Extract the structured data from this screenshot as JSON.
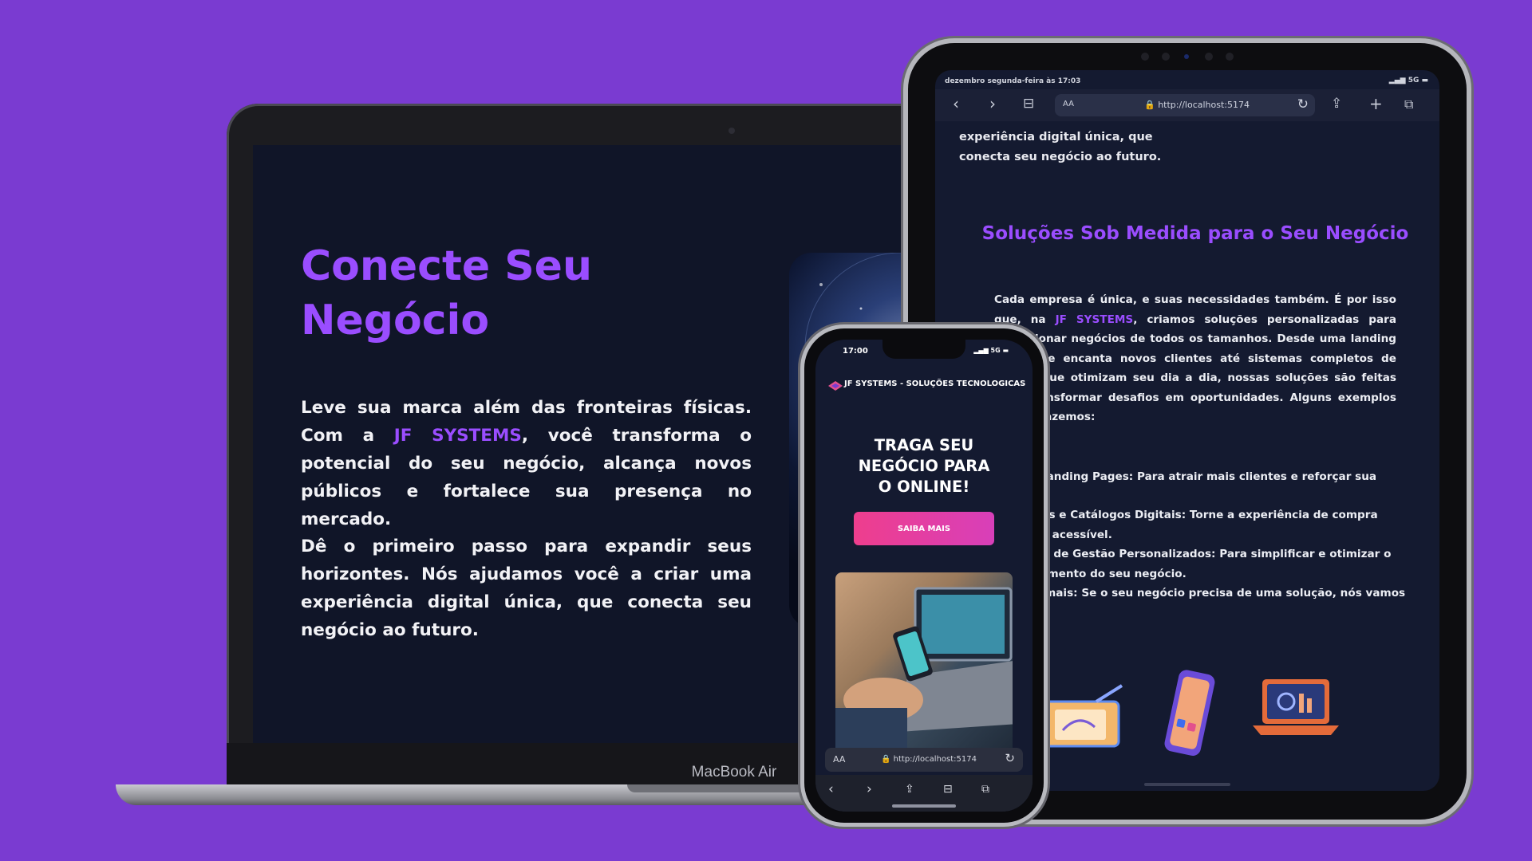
{
  "laptop": {
    "model_label": "MacBook Air",
    "hero": {
      "title_line1": "Conecte Seu",
      "title_line2": "Negócio",
      "para1_pre": "Leve sua marca além das fronteiras físicas. Com a ",
      "brand": "JF SYSTEMS",
      "para1_post": ", você transforma o potencial do seu negócio, alcança novos públicos e fortalece sua presença no mercado.",
      "para2": "Dê o primeiro passo para expandir seus horizontes. Nós ajudamos você a criar uma experiência digital única, que conecta seu negócio ao futuro."
    }
  },
  "tablet": {
    "status_left": "dezembro segunda-feira às 17:03",
    "status_right": "5G",
    "toolbar": {
      "text_size": "AA",
      "url": "http://localhost:5174"
    },
    "top_lines": [
      "experiência digital única, que",
      "conecta seu negócio ao futuro."
    ],
    "heading": "Soluções Sob Medida para o Seu Negócio",
    "para_pre": "Cada empresa é única, e suas necessidades também. É por isso que, na ",
    "brand": "JF SYSTEMS",
    "para_post": ", criamos soluções personalizadas para impulsionar negócios de todos os tamanhos. Desde uma landing page que encanta novos clientes até sistemas completos de gestão que otimizam seu dia a dia, nossas soluções são feitas para transformar desafios em oportunidades. Alguns exemplos do que fazemos:",
    "list": [
      "Sites e Landing Pages: Para atrair mais clientes e reforçar sua",
      "Cardápios e Catálogos Digitais: Torne a experiência de compra prática e acessível.",
      "Sistemas de Gestão Personalizados: Para simplificar e otimizar o gerenciamento do seu negócio.",
      "E muito mais: Se o seu negócio precisa de uma solução, nós vamos criar."
    ]
  },
  "phone": {
    "time": "17:00",
    "status_right": "5G",
    "brand": "JF SYSTEMS - SOLUÇÕES TECNOLOGICAS",
    "headline": [
      "TRAGA SEU",
      "NEGÓCIO PARA",
      "O ONLINE!"
    ],
    "cta": "SAIBA MAIS",
    "address": {
      "text_size": "AA",
      "url": "http://localhost:5174"
    }
  },
  "colors": {
    "background": "#7a3bd1",
    "accent": "#9a4dff",
    "screen_bg": "#101528",
    "cta_start": "#ee3e8d",
    "cta_end": "#d83fb9"
  }
}
